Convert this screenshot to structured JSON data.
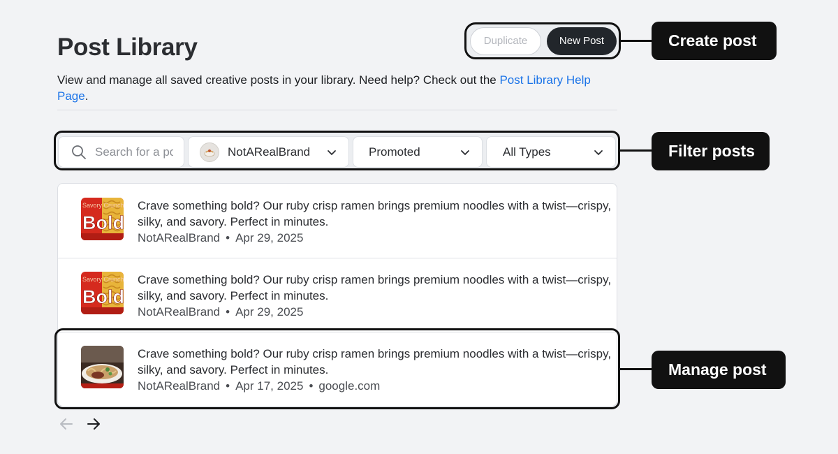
{
  "header": {
    "title": "Post Library",
    "description_prefix": "View and manage all saved creative posts in your library. Need help? Check out the ",
    "help_link": "Post Library Help Page",
    "description_suffix": "."
  },
  "actions": {
    "duplicate_label": "Duplicate",
    "new_post_label": "New Post"
  },
  "callouts": {
    "create": "Create post",
    "filter": "Filter posts",
    "manage": "Manage post"
  },
  "filters": {
    "search_placeholder": "Search for a post",
    "brand": "NotARealBrand",
    "status": "Promoted",
    "type": "All Types"
  },
  "posts": [
    {
      "text": "Crave something bold? Our ruby crisp ramen brings premium noodles with a twist—crispy, silky, and savory. Perfect in minutes.",
      "brand": "NotARealBrand",
      "date": "Apr 29, 2025",
      "domain": "",
      "thumb_text_top": "Savory Crunchy",
      "thumb_text_main": "Bold"
    },
    {
      "text": "Crave something bold? Our ruby crisp ramen brings premium noodles with a twist—crispy, silky, and savory. Perfect in minutes.",
      "brand": "NotARealBrand",
      "date": "Apr 29, 2025",
      "domain": "",
      "thumb_text_top": "Savory Crunchy",
      "thumb_text_main": "Bold"
    },
    {
      "text": "Crave something bold? Our ruby crisp ramen brings premium noodles with a twist—crispy, silky, and savory. Perfect in minutes.",
      "brand": "NotARealBrand",
      "date": "Apr 17, 2025",
      "domain": "google.com"
    }
  ],
  "icons": {
    "search": "search-icon",
    "chevron": "chevron-down-icon",
    "prev": "arrow-left-icon",
    "next": "arrow-right-icon"
  },
  "colors": {
    "link": "#1a73e8",
    "primary_button": "#22262b",
    "callout": "#111111",
    "background": "#f2f3f5"
  }
}
